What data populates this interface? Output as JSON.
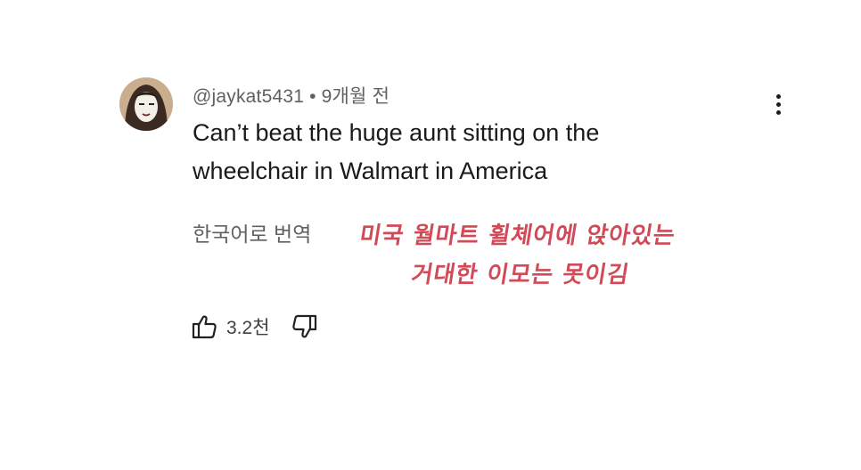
{
  "comment": {
    "username": "@jaykat5431",
    "separator": "•",
    "timestamp": "9개월 전",
    "text_line1": "Can’t beat the huge aunt sitting on the",
    "text_line2": "wheelchair in Walmart in America",
    "translate_label": "한국어로 번역",
    "like_count": "3.2천",
    "avatar_icon": "avatar-face-icon",
    "more_icon": "more-vertical-icon",
    "like_icon": "thumbs-up-icon",
    "dislike_icon": "thumbs-down-icon"
  },
  "annotation": {
    "line1": "미국 월마트 휠체어에 앉아있는",
    "line2": "거대한 이모는 못이김",
    "color": "#d24a58"
  }
}
